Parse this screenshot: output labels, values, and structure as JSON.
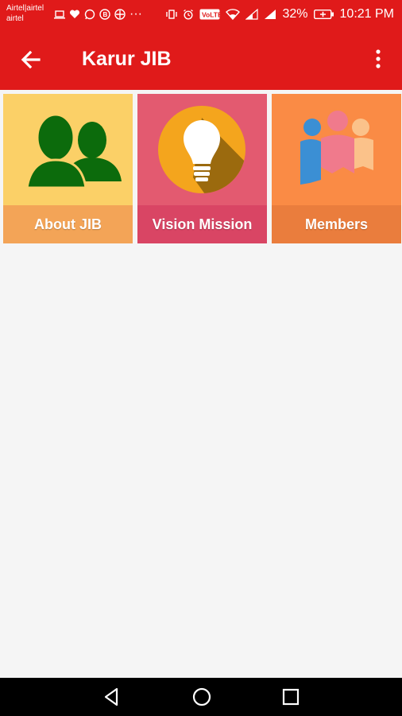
{
  "status_bar": {
    "carrier_line1": "Airtel|airtel",
    "carrier_line2": "airtel",
    "more_dots": "···",
    "battery_percent": "32%",
    "time": "10:21 PM",
    "volte_badge": "VoLTE"
  },
  "app_bar": {
    "title": "Karur JIB",
    "background_color": "#e01a1a"
  },
  "tiles": [
    {
      "label": "About JIB",
      "icon": "people-icon",
      "color": "#fbd067"
    },
    {
      "label": "Vision Mission",
      "icon": "lightbulb-icon",
      "color": "#e35a70"
    },
    {
      "label": "Members",
      "icon": "members-icon",
      "color": "#fa8b45"
    }
  ],
  "nav_bar": {
    "back": "back-triangle-icon",
    "home": "home-circle-icon",
    "recents": "recents-square-icon"
  }
}
